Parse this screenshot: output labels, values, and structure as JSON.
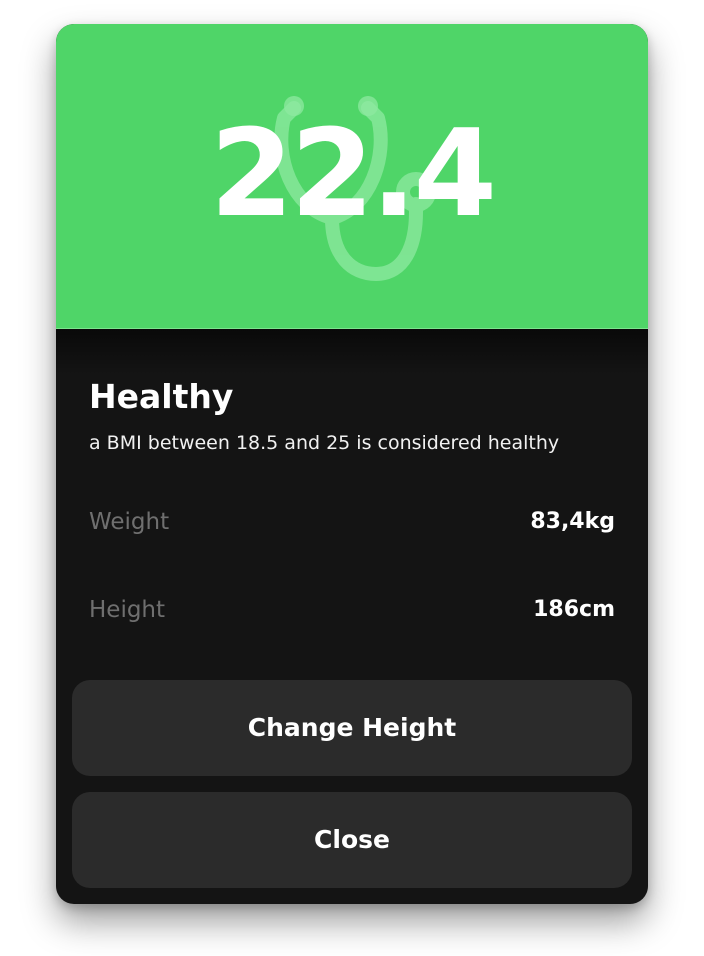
{
  "bmi": {
    "value": "22.4"
  },
  "status": {
    "title": "Healthy",
    "description": "a BMI between 18.5 and 25 is considered healthy"
  },
  "measurements": [
    {
      "label": "Weight",
      "value": "83,4kg"
    },
    {
      "label": "Height",
      "value": "186cm"
    }
  ],
  "buttons": {
    "change_height": "Change Height",
    "close": "Close"
  },
  "colors": {
    "accent": "#4fd568",
    "card_background": "#141414",
    "button_background": "#2b2b2b",
    "muted_text": "#6f6f6f"
  },
  "icons": {
    "hero": "stethoscope-icon"
  }
}
